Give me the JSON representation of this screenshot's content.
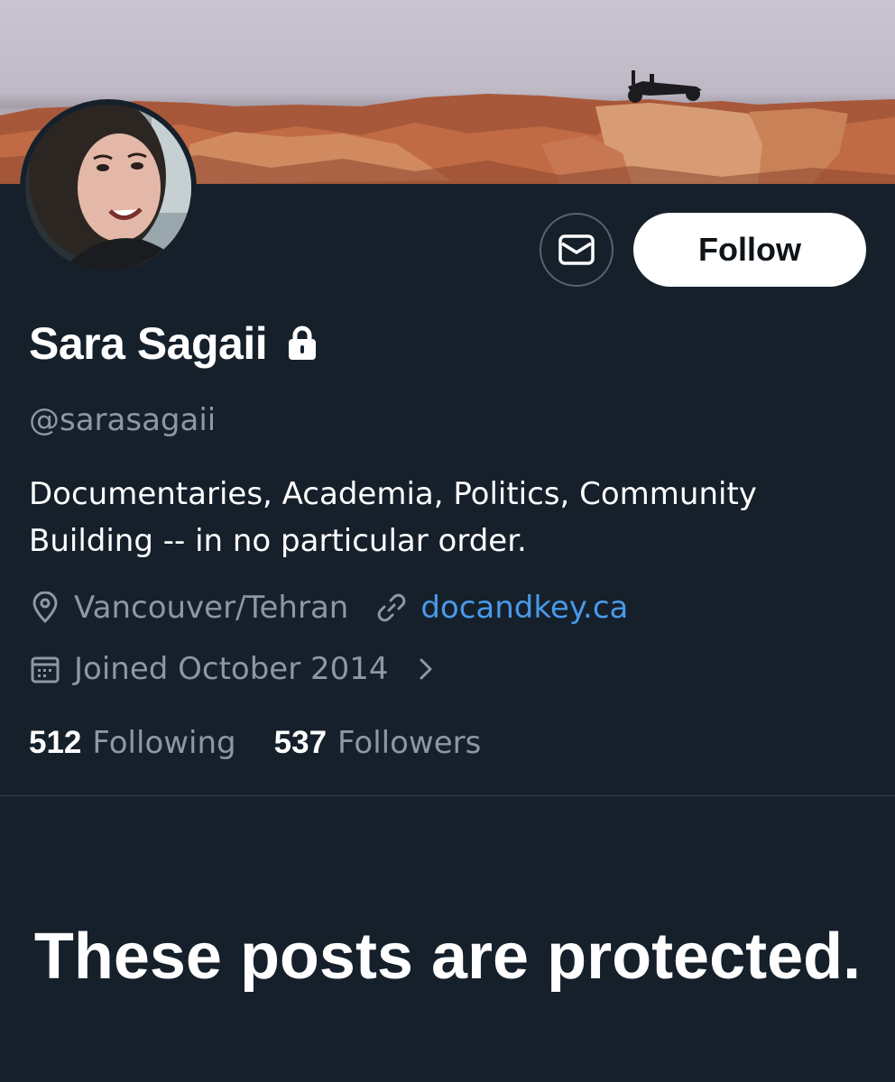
{
  "profile": {
    "name": "Sara Sagaii",
    "handle": "@sarasagaii",
    "bio": "Documentaries, Academia, Politics, Community Building -- in no particular order.",
    "location": "Vancouver/Tehran",
    "website": "docandkey.ca",
    "joined": "Joined October 2014",
    "protected": true
  },
  "actions": {
    "follow_label": "Follow",
    "message_icon": "envelope-icon"
  },
  "stats": {
    "following_count": "512",
    "following_label": "Following",
    "followers_count": "537",
    "followers_label": "Followers"
  },
  "empty_state": {
    "title": "These posts are protected."
  },
  "colors": {
    "background": "#15202b",
    "secondary_text": "#8b98a5",
    "link": "#4a99e9",
    "divider": "#38444d"
  }
}
